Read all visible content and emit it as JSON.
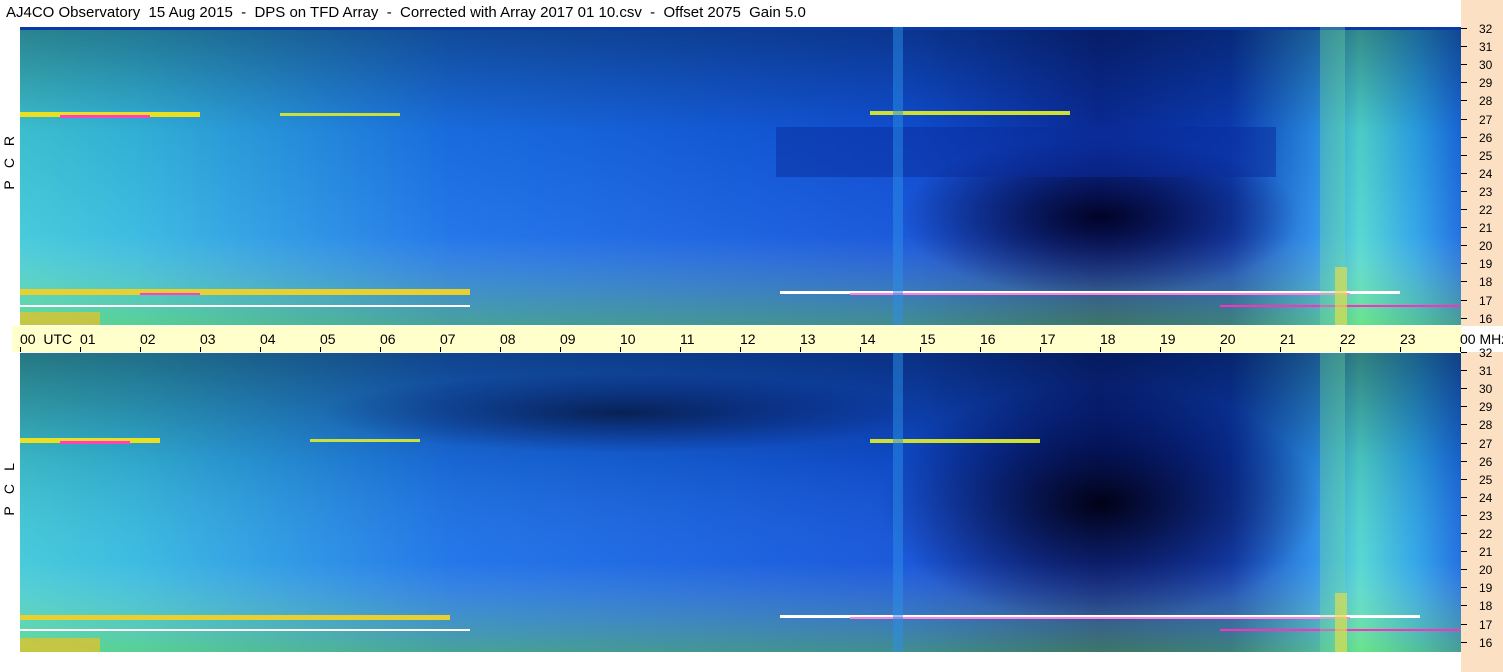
{
  "title": "AJ4CO Observatory  15 Aug 2015  -  DPS on TFD Array  -  Corrected with Array 2017 01 10.csv  -  Offset 2075  Gain 5.0",
  "panels": [
    {
      "id": "rcp",
      "polarization_letters": [
        "R",
        "C",
        "P"
      ]
    },
    {
      "id": "lcp",
      "polarization_letters": [
        "L",
        "C",
        "P"
      ]
    }
  ],
  "time_axis": {
    "labels": [
      "00  UTC",
      "01",
      "02",
      "03",
      "04",
      "05",
      "06",
      "07",
      "08",
      "09",
      "10",
      "11",
      "12",
      "13",
      "14",
      "15",
      "16",
      "17",
      "18",
      "19",
      "20",
      "21",
      "22",
      "23",
      "00 MHz"
    ]
  },
  "frequency_axis": {
    "unit": "MHz",
    "labels": [
      "32",
      "31",
      "30",
      "29",
      "28",
      "27",
      "26",
      "25",
      "24",
      "23",
      "22",
      "21",
      "20",
      "19",
      "18",
      "17",
      "16"
    ]
  },
  "colors": {
    "background": "#ffffff",
    "time_axis_band": "#ffffcc",
    "frequency_scale_band": "#fce0c4",
    "spectrogram_low": "#000a4a",
    "spectrogram_mid": "#1f6ae0",
    "spectrogram_high": "#ffff40",
    "spectrogram_peak": "#ff30c0"
  }
}
